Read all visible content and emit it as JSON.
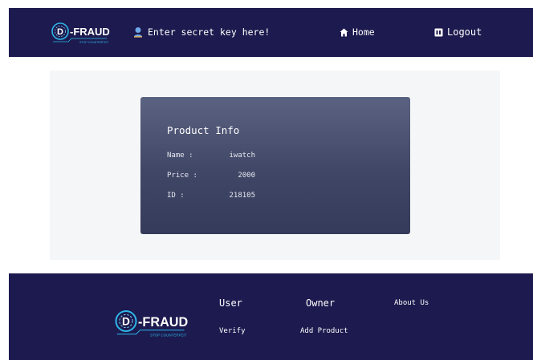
{
  "colors": {
    "nav_bg": "#1c1a4e",
    "panel_bg": "#f5f6f8",
    "card_top": "#5b6282",
    "card_bottom": "#353b5a",
    "accent": "#2fb6e8",
    "user_icon": "#6fa8e8"
  },
  "header": {
    "logo_text": "D-FRAUD",
    "logo_tagline": "STOP COUNTERFEIT",
    "secret_key": {
      "icon": "user-pin-icon",
      "placeholder": "Enter secret key here!"
    },
    "home": {
      "icon": "home-icon",
      "label": "Home"
    },
    "logout": {
      "icon": "logout-icon",
      "label": "Logout"
    }
  },
  "product_info": {
    "title": "Product Info",
    "fields": [
      {
        "label": "Name :",
        "value": "iwatch"
      },
      {
        "label": "Price :",
        "value": "2000"
      },
      {
        "label": "ID :",
        "value": "218105"
      }
    ]
  },
  "footer": {
    "logo_text": "D-FRAUD",
    "logo_tagline": "STOP COUNTERFEIT",
    "user_heading": "User",
    "owner_heading": "Owner",
    "about_link": "About Us",
    "verify_link": "Verify",
    "add_product_link": "Add Product"
  }
}
